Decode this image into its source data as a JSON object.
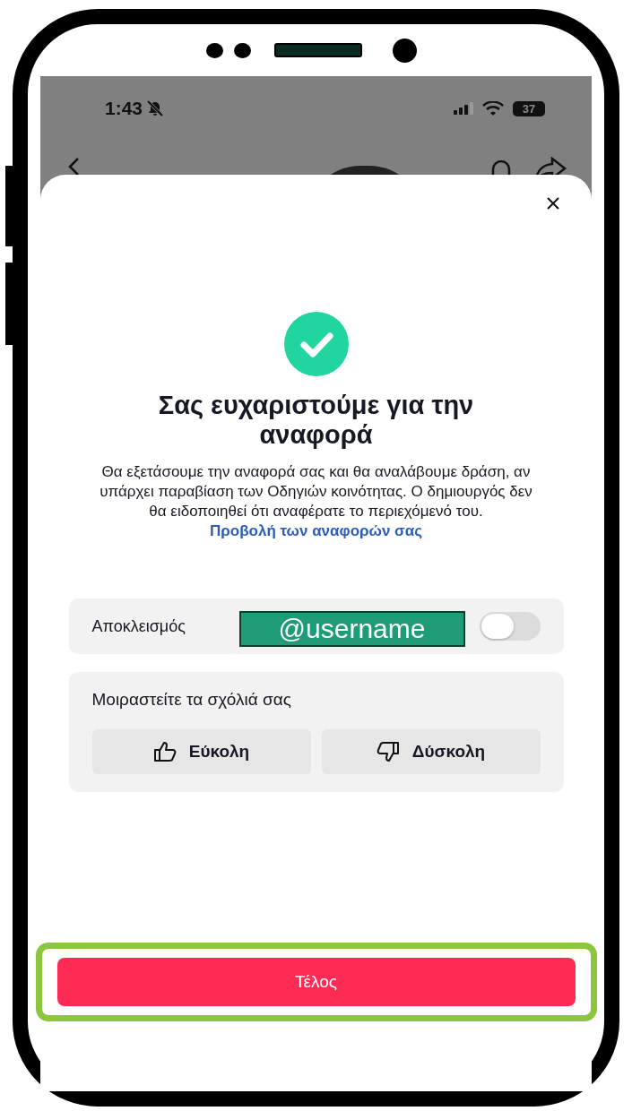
{
  "status_bar": {
    "time": "1:43",
    "battery": "37"
  },
  "sheet": {
    "title": "Σας ευχαριστούμε για την αναφορά",
    "message": {
      "text": "Θα εξετάσουμε την αναφορά σας και θα αναλάβουμε δράση, αν υπάρχει παραβίαση των Οδηγιών κοινότητας. Ο δημιουργός δεν θα ειδοποιηθεί ότι αναφέρατε το περιεχόμενό του.",
      "link": "Προβολή των αναφορών σας"
    },
    "block_row": {
      "label": "Αποκλεισμός",
      "redaction": "@username",
      "on": false
    },
    "feedback": {
      "title": "Μοιραστείτε τα σχόλιά σας",
      "buttons": [
        {
          "kind": "like",
          "label": "Εύκολη"
        },
        {
          "kind": "dislike",
          "label": "Δύσκολη"
        }
      ]
    },
    "done_button": {
      "label": "Τέλος",
      "highlighted": true
    }
  }
}
